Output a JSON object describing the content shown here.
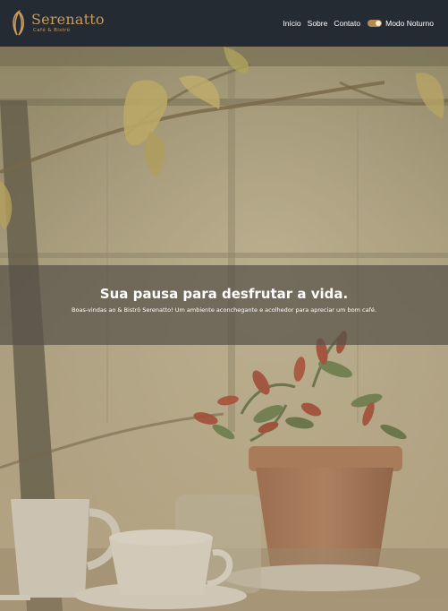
{
  "brand": {
    "name": "Serenatto",
    "tagline": "Café & Bistrô",
    "logo_icon": "coffee-bean-icon",
    "color": "#c79a5d"
  },
  "nav": {
    "items": [
      "Início",
      "Sobre",
      "Contato"
    ],
    "toggle_label": "Modo Noturno",
    "toggle_on": true
  },
  "hero": {
    "title": "Sua pausa para desfrutar a vida.",
    "subtitle": "Boas-vindas ao & Bistrô Serenatto! Um ambiente aconchegante e acolhedor para apreciar um bom café."
  },
  "colors": {
    "header_bg": "#252b33",
    "accent": "#b58a52",
    "banner_bg": "rgba(88,82,74,0.72)"
  }
}
